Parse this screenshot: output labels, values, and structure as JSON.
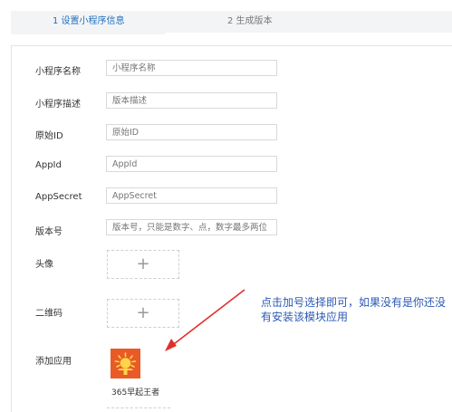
{
  "steps": {
    "step1": "1 设置小程序信息",
    "step2": "2 生成版本"
  },
  "form": {
    "name": {
      "label": "小程序名称",
      "placeholder": "小程序名称"
    },
    "desc": {
      "label": "小程序描述",
      "placeholder": "版本描述"
    },
    "origin_id": {
      "label": "原始ID",
      "placeholder": "原始ID"
    },
    "appid": {
      "label": "AppId",
      "placeholder": "AppId"
    },
    "appsecret": {
      "label": "AppSecret",
      "placeholder": "AppSecret"
    },
    "version": {
      "label": "版本号",
      "placeholder": "版本号，只能是数字、点，数字最多两位"
    },
    "avatar": {
      "label": "头像",
      "plus": "+"
    },
    "qrcode": {
      "label": "二维码",
      "plus": "+"
    },
    "add_app": {
      "label": "添加应用"
    }
  },
  "app": {
    "name": "365早起王者",
    "icon": "sunrise-icon",
    "icon_color": "#e85b26"
  },
  "annotation": {
    "text": "点击加号选择即可，如果没有是你还没有安装该模块应用",
    "color": "#2c59b5",
    "arrow_color": "#e0302b"
  }
}
